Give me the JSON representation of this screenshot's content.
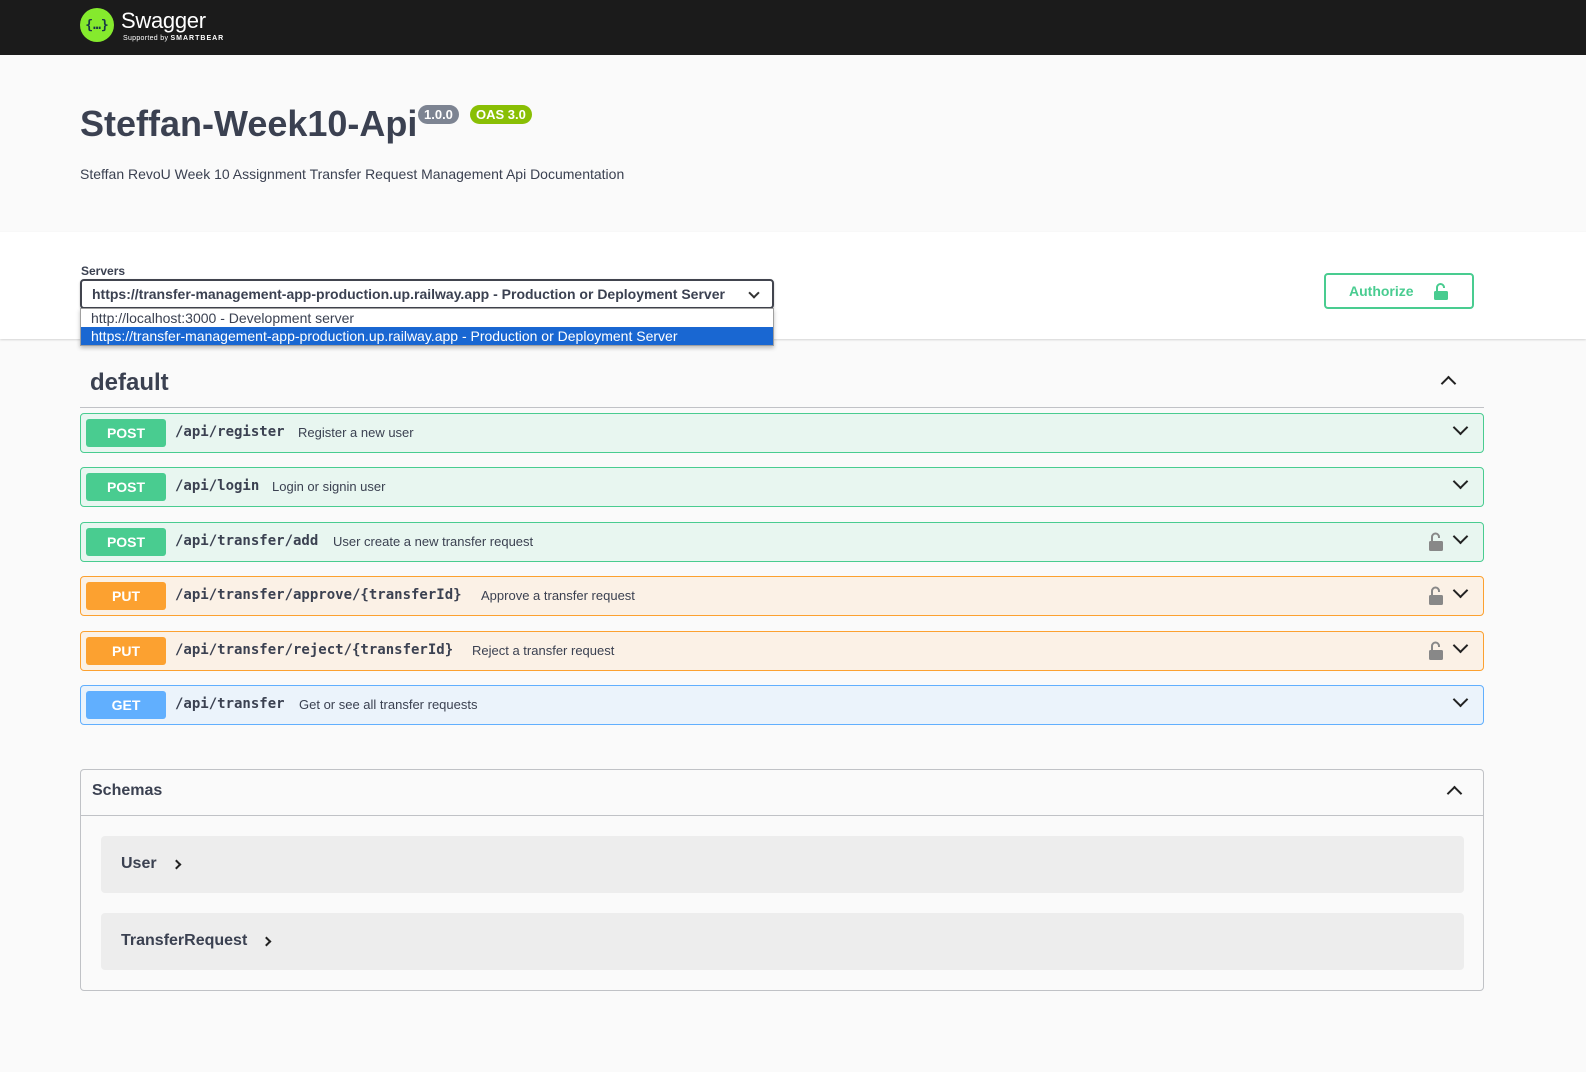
{
  "topbar": {
    "brand": "Swagger",
    "tagline_prefix": "Supported by",
    "tagline_brand": "SMARTBEAR",
    "logo_glyph": "{…}"
  },
  "info": {
    "title": "Steffan-Week10-Api",
    "version": "1.0.0",
    "oas": "OAS 3.0",
    "description": "Steffan RevoU Week 10 Assignment Transfer Request Management Api Documentation"
  },
  "servers": {
    "label": "Servers",
    "selected": "https://transfer-management-app-production.up.railway.app - Production or Deployment Server",
    "options": [
      "http://localhost:3000 - Development server",
      "https://transfer-management-app-production.up.railway.app - Production or Deployment Server"
    ]
  },
  "authorize": {
    "label": "Authorize",
    "icon": "unlock-icon"
  },
  "tag": {
    "name": "default"
  },
  "operations": [
    {
      "method": "POST",
      "path": "/api/register",
      "summary": "Register a new user",
      "locked": false
    },
    {
      "method": "POST",
      "path": "/api/login",
      "summary": "Login or signin user",
      "locked": false
    },
    {
      "method": "POST",
      "path": "/api/transfer/add",
      "summary": "User create a new transfer request",
      "locked": true
    },
    {
      "method": "PUT",
      "path": "/api/transfer/approve/{transferId}",
      "summary": "Approve a transfer request",
      "locked": true
    },
    {
      "method": "PUT",
      "path": "/api/transfer/reject/{transferId}",
      "summary": "Reject a transfer request",
      "locked": true
    },
    {
      "method": "GET",
      "path": "/api/transfer",
      "summary": "Get or see all transfer requests",
      "locked": false
    }
  ],
  "schemas": {
    "title": "Schemas",
    "models": [
      "User",
      "TransferRequest"
    ]
  },
  "colors": {
    "post": "#49cc90",
    "put": "#fca130",
    "get": "#61affe",
    "topbar": "#1b1b1b",
    "logo": "#85ea2d"
  }
}
